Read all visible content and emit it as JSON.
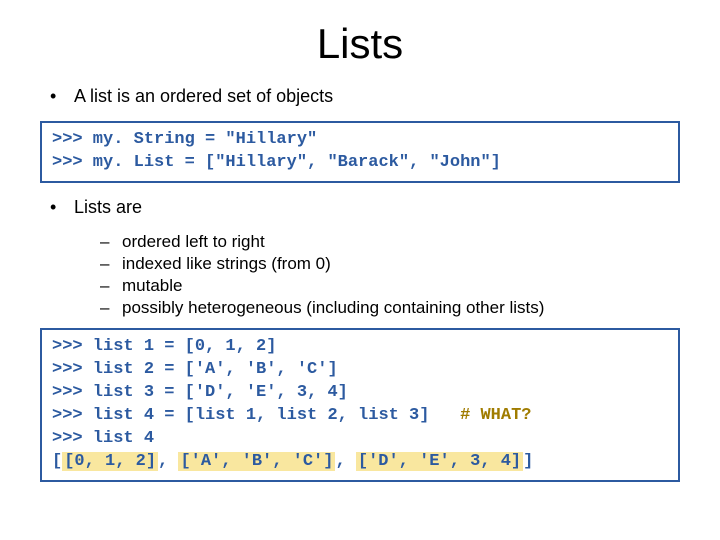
{
  "title": "Lists",
  "bullet1": "A list is an ordered set of objects",
  "code1": {
    "l1": ">>> my. String = \"Hillary\"",
    "l2": ">>> my. List = [\"Hillary\", \"Barack\", \"John\"]"
  },
  "bullet2": "Lists are",
  "sub": {
    "a": "ordered left to right",
    "b": "indexed like strings (from 0)",
    "c": "mutable",
    "d": "possibly heterogeneous (including containing other lists)"
  },
  "code2": {
    "l1": ">>> list 1 = [0, 1, 2]",
    "l2": ">>> list 2 = ['A', 'B', 'C']",
    "l3": ">>> list 3 = ['D', 'E', 3, 4]",
    "l4a": ">>> list 4 = [list 1, list 2, list 3]   ",
    "l4b": "# WHAT?",
    "l5": ">>> list 4",
    "l6a": "[",
    "l6b": "[0, 1, 2]",
    "l6c": ", ",
    "l6d": "['A', 'B', 'C']",
    "l6e": ", ",
    "l6f": "['D', 'E', 3, 4]",
    "l6g": "]"
  }
}
